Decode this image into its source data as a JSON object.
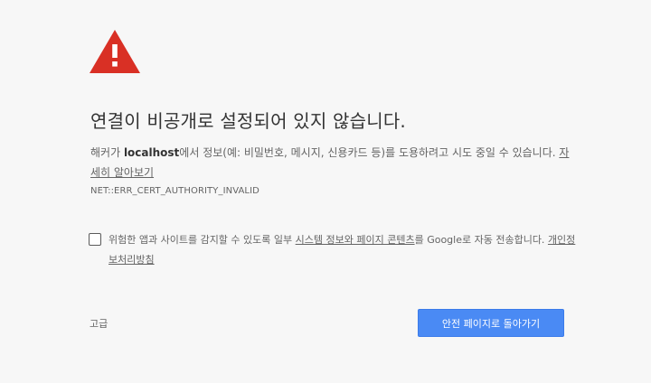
{
  "icon": {
    "name": "warning-triangle-icon",
    "color": "#d93025"
  },
  "title": "연결이 비공개로 설정되어 있지 않습니다.",
  "description": {
    "prefix": "해커가 ",
    "host": "localhost",
    "suffix": "에서 정보(예: 비밀번호, 메시지, 신용카드 등)를 도용하려고 시도 중일 수 있습니다. ",
    "learn_more": "자세히 알아보기"
  },
  "error_code": "NET::ERR_CERT_AUTHORITY_INVALID",
  "opt_in": {
    "text_before": "위험한 앱과 사이트를 감지할 수 있도록 일부 ",
    "link1": "시스템 정보와 페이지 콘텐츠",
    "text_middle": "를 Google로 자동 전송합니다. ",
    "link2": "개인정보처리방침",
    "checked": false
  },
  "advanced_button": "고급",
  "back_button": "안전 페이지로 돌아가기",
  "colors": {
    "primary_button": "#4a8af4",
    "background": "#f7f7f7"
  }
}
